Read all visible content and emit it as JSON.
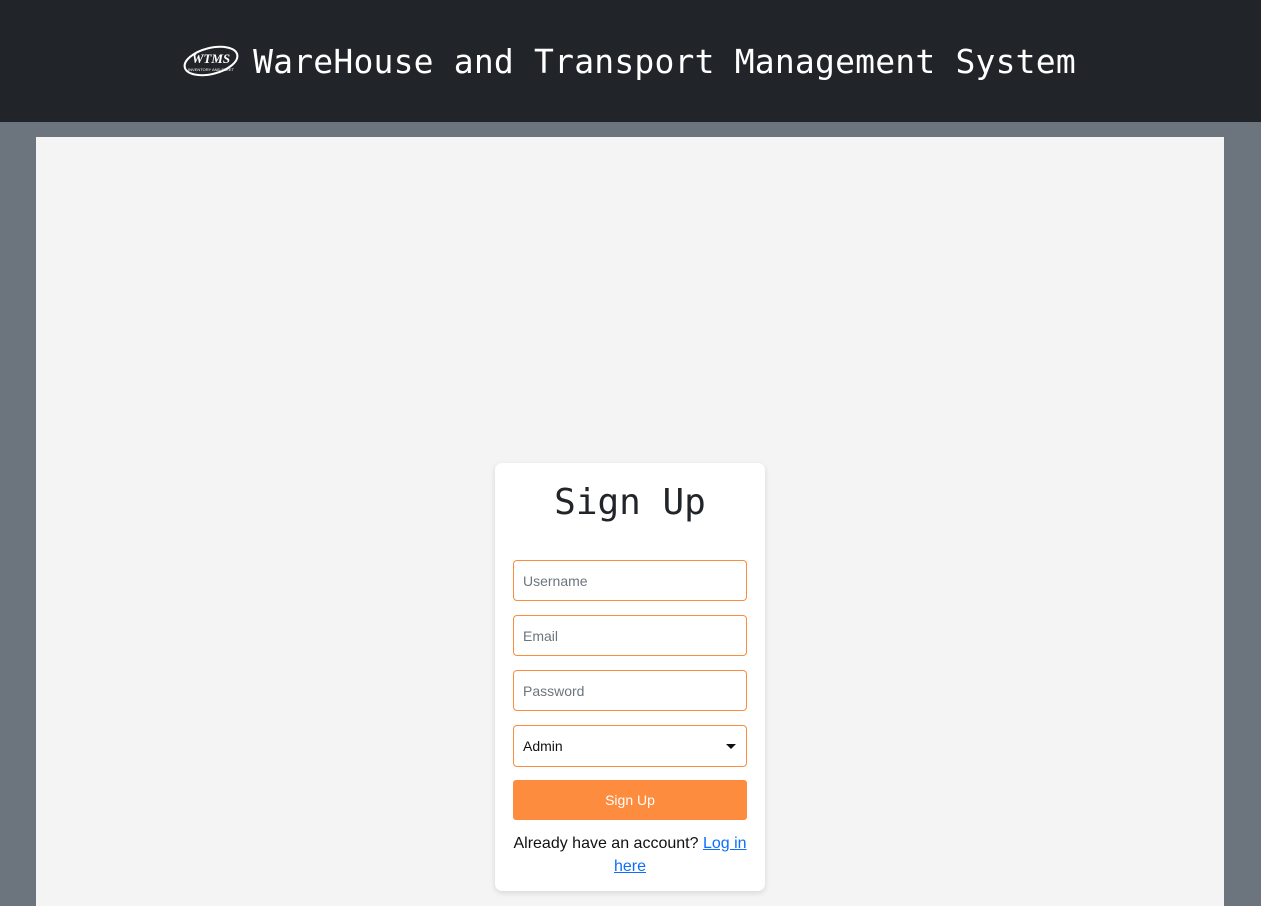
{
  "header": {
    "app_title": "WareHouse and Transport Management System",
    "logo_text": "WTMS",
    "logo_subtext": "INVENTORY AND FLEET"
  },
  "form": {
    "title": "Sign Up",
    "username_placeholder": "Username",
    "email_placeholder": "Email",
    "password_placeholder": "Password",
    "role_selected": "Admin",
    "submit_label": "Sign Up",
    "login_prompt": "Already have an account?",
    "login_link": "Log in here"
  },
  "colors": {
    "header_bg": "#212529",
    "page_bg": "#6c757d",
    "content_bg": "#f4f4f4",
    "accent": "#fd8c3e",
    "link": "#0d6efd"
  }
}
